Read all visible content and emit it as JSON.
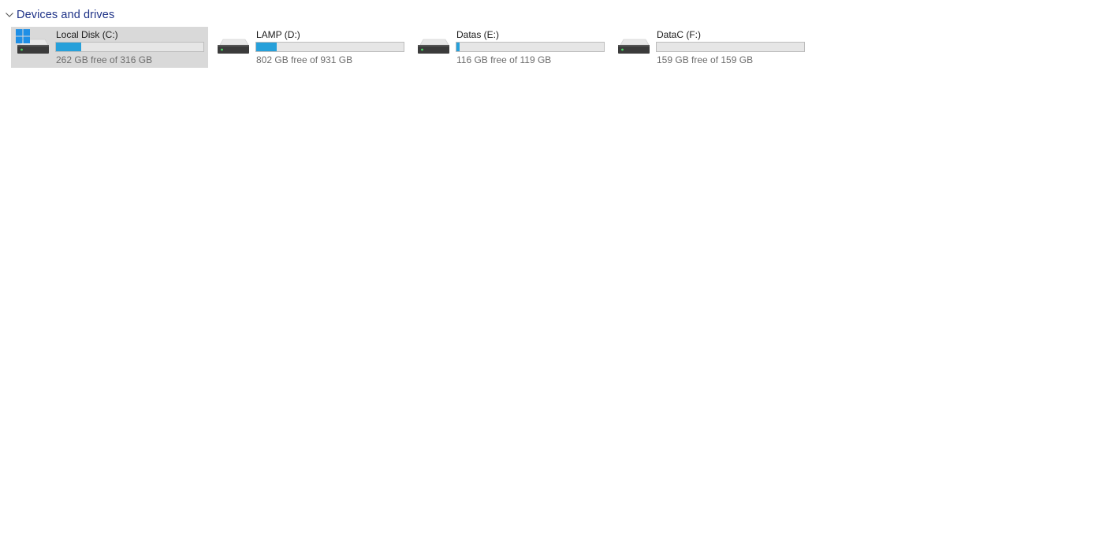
{
  "group": {
    "title": "Devices and drives",
    "chevron_icon": "chevron-down-icon"
  },
  "colors": {
    "accent": "#26a0da",
    "group_title": "#1e3287",
    "selected_bg": "#d9d9d9"
  },
  "drives": [
    {
      "name": "Local Disk (C:)",
      "free_text": "262 GB free of 316 GB",
      "used_fraction": 0.17,
      "icon": "system-drive-icon",
      "selected": true
    },
    {
      "name": "LAMP (D:)",
      "free_text": "802 GB free of 931 GB",
      "used_fraction": 0.14,
      "icon": "hard-drive-icon",
      "selected": false
    },
    {
      "name": "Datas (E:)",
      "free_text": "116 GB free of 119 GB",
      "used_fraction": 0.02,
      "icon": "hard-drive-icon",
      "selected": false
    },
    {
      "name": "DataC (F:)",
      "free_text": "159 GB free of 159 GB",
      "used_fraction": 0.0,
      "icon": "hard-drive-icon",
      "selected": false
    }
  ]
}
